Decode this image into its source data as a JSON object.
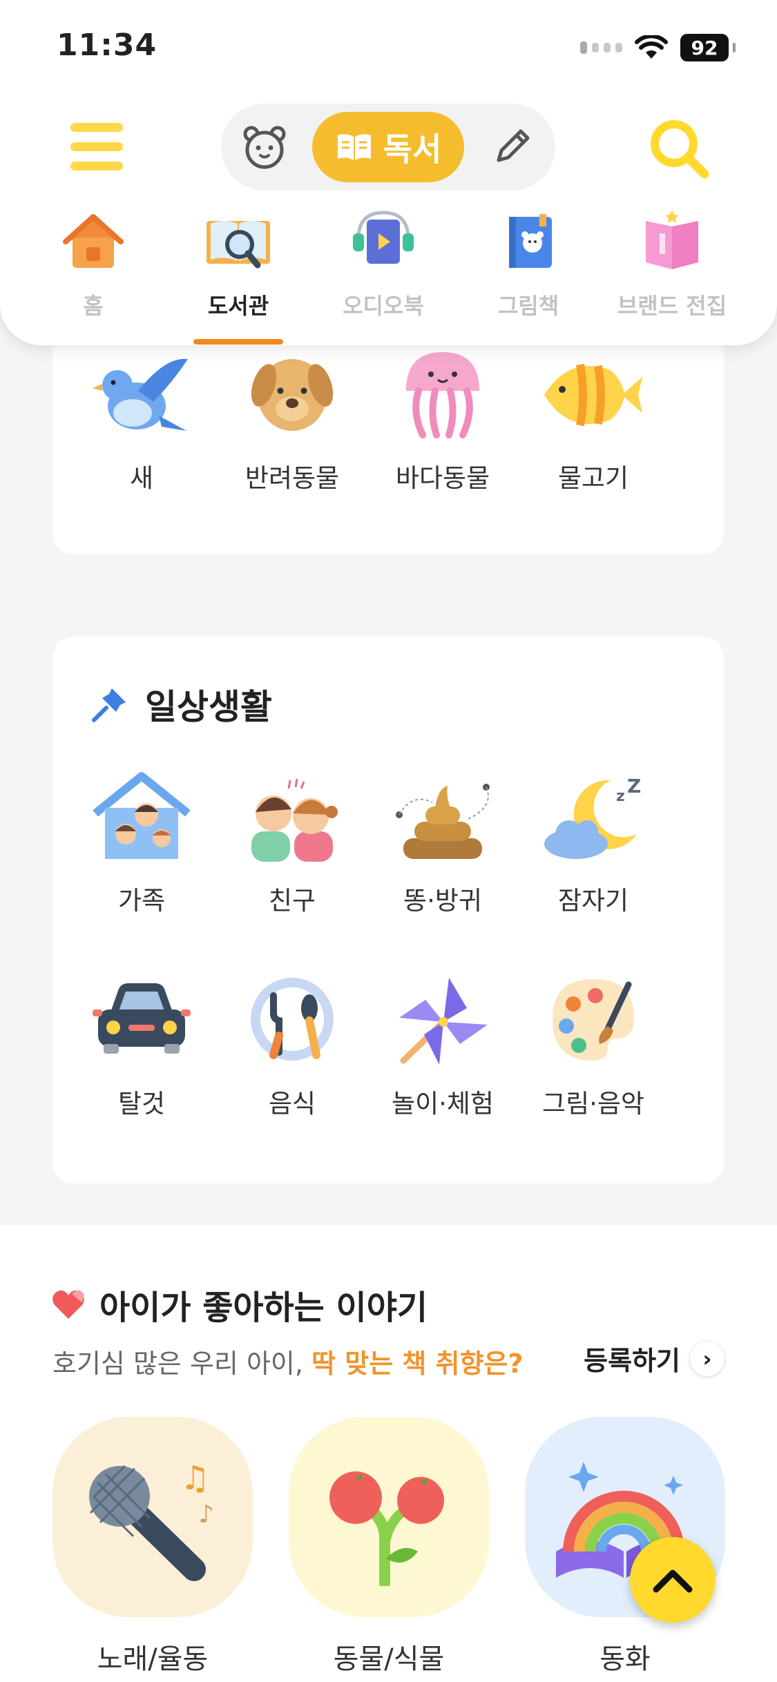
{
  "status": {
    "time": "11:34",
    "battery": "92"
  },
  "header": {
    "mode_active": "독서"
  },
  "tabs": [
    {
      "label": "홈",
      "active": false
    },
    {
      "label": "도서관",
      "active": true
    },
    {
      "label": "오디오북",
      "active": false
    },
    {
      "label": "그림책",
      "active": false
    },
    {
      "label": "브랜드 전집",
      "active": false
    }
  ],
  "animals": [
    {
      "label": "새"
    },
    {
      "label": "반려동물"
    },
    {
      "label": "바다동물"
    },
    {
      "label": "물고기"
    }
  ],
  "daily": {
    "title": "일상생활",
    "items": [
      {
        "label": "가족"
      },
      {
        "label": "친구"
      },
      {
        "label": "똥·방귀"
      },
      {
        "label": "잠자기"
      },
      {
        "label": "탈것"
      },
      {
        "label": "음식"
      },
      {
        "label": "놀이·체험"
      },
      {
        "label": "그림·음악"
      }
    ]
  },
  "story": {
    "title": "아이가 좋아하는 이야기",
    "subtitle_plain": "호기심 많은 우리 아이, ",
    "subtitle_highlight": "딱 맞는 책 취향은?",
    "register_label": "등록하기",
    "items": [
      {
        "label": "노래/율동"
      },
      {
        "label": "동물/식물"
      },
      {
        "label": "동화"
      }
    ]
  },
  "colors": {
    "accent": "#f5bd2e",
    "tab_underline": "#f08a1e",
    "highlight": "#f0942a",
    "fab": "#ffd92e"
  }
}
